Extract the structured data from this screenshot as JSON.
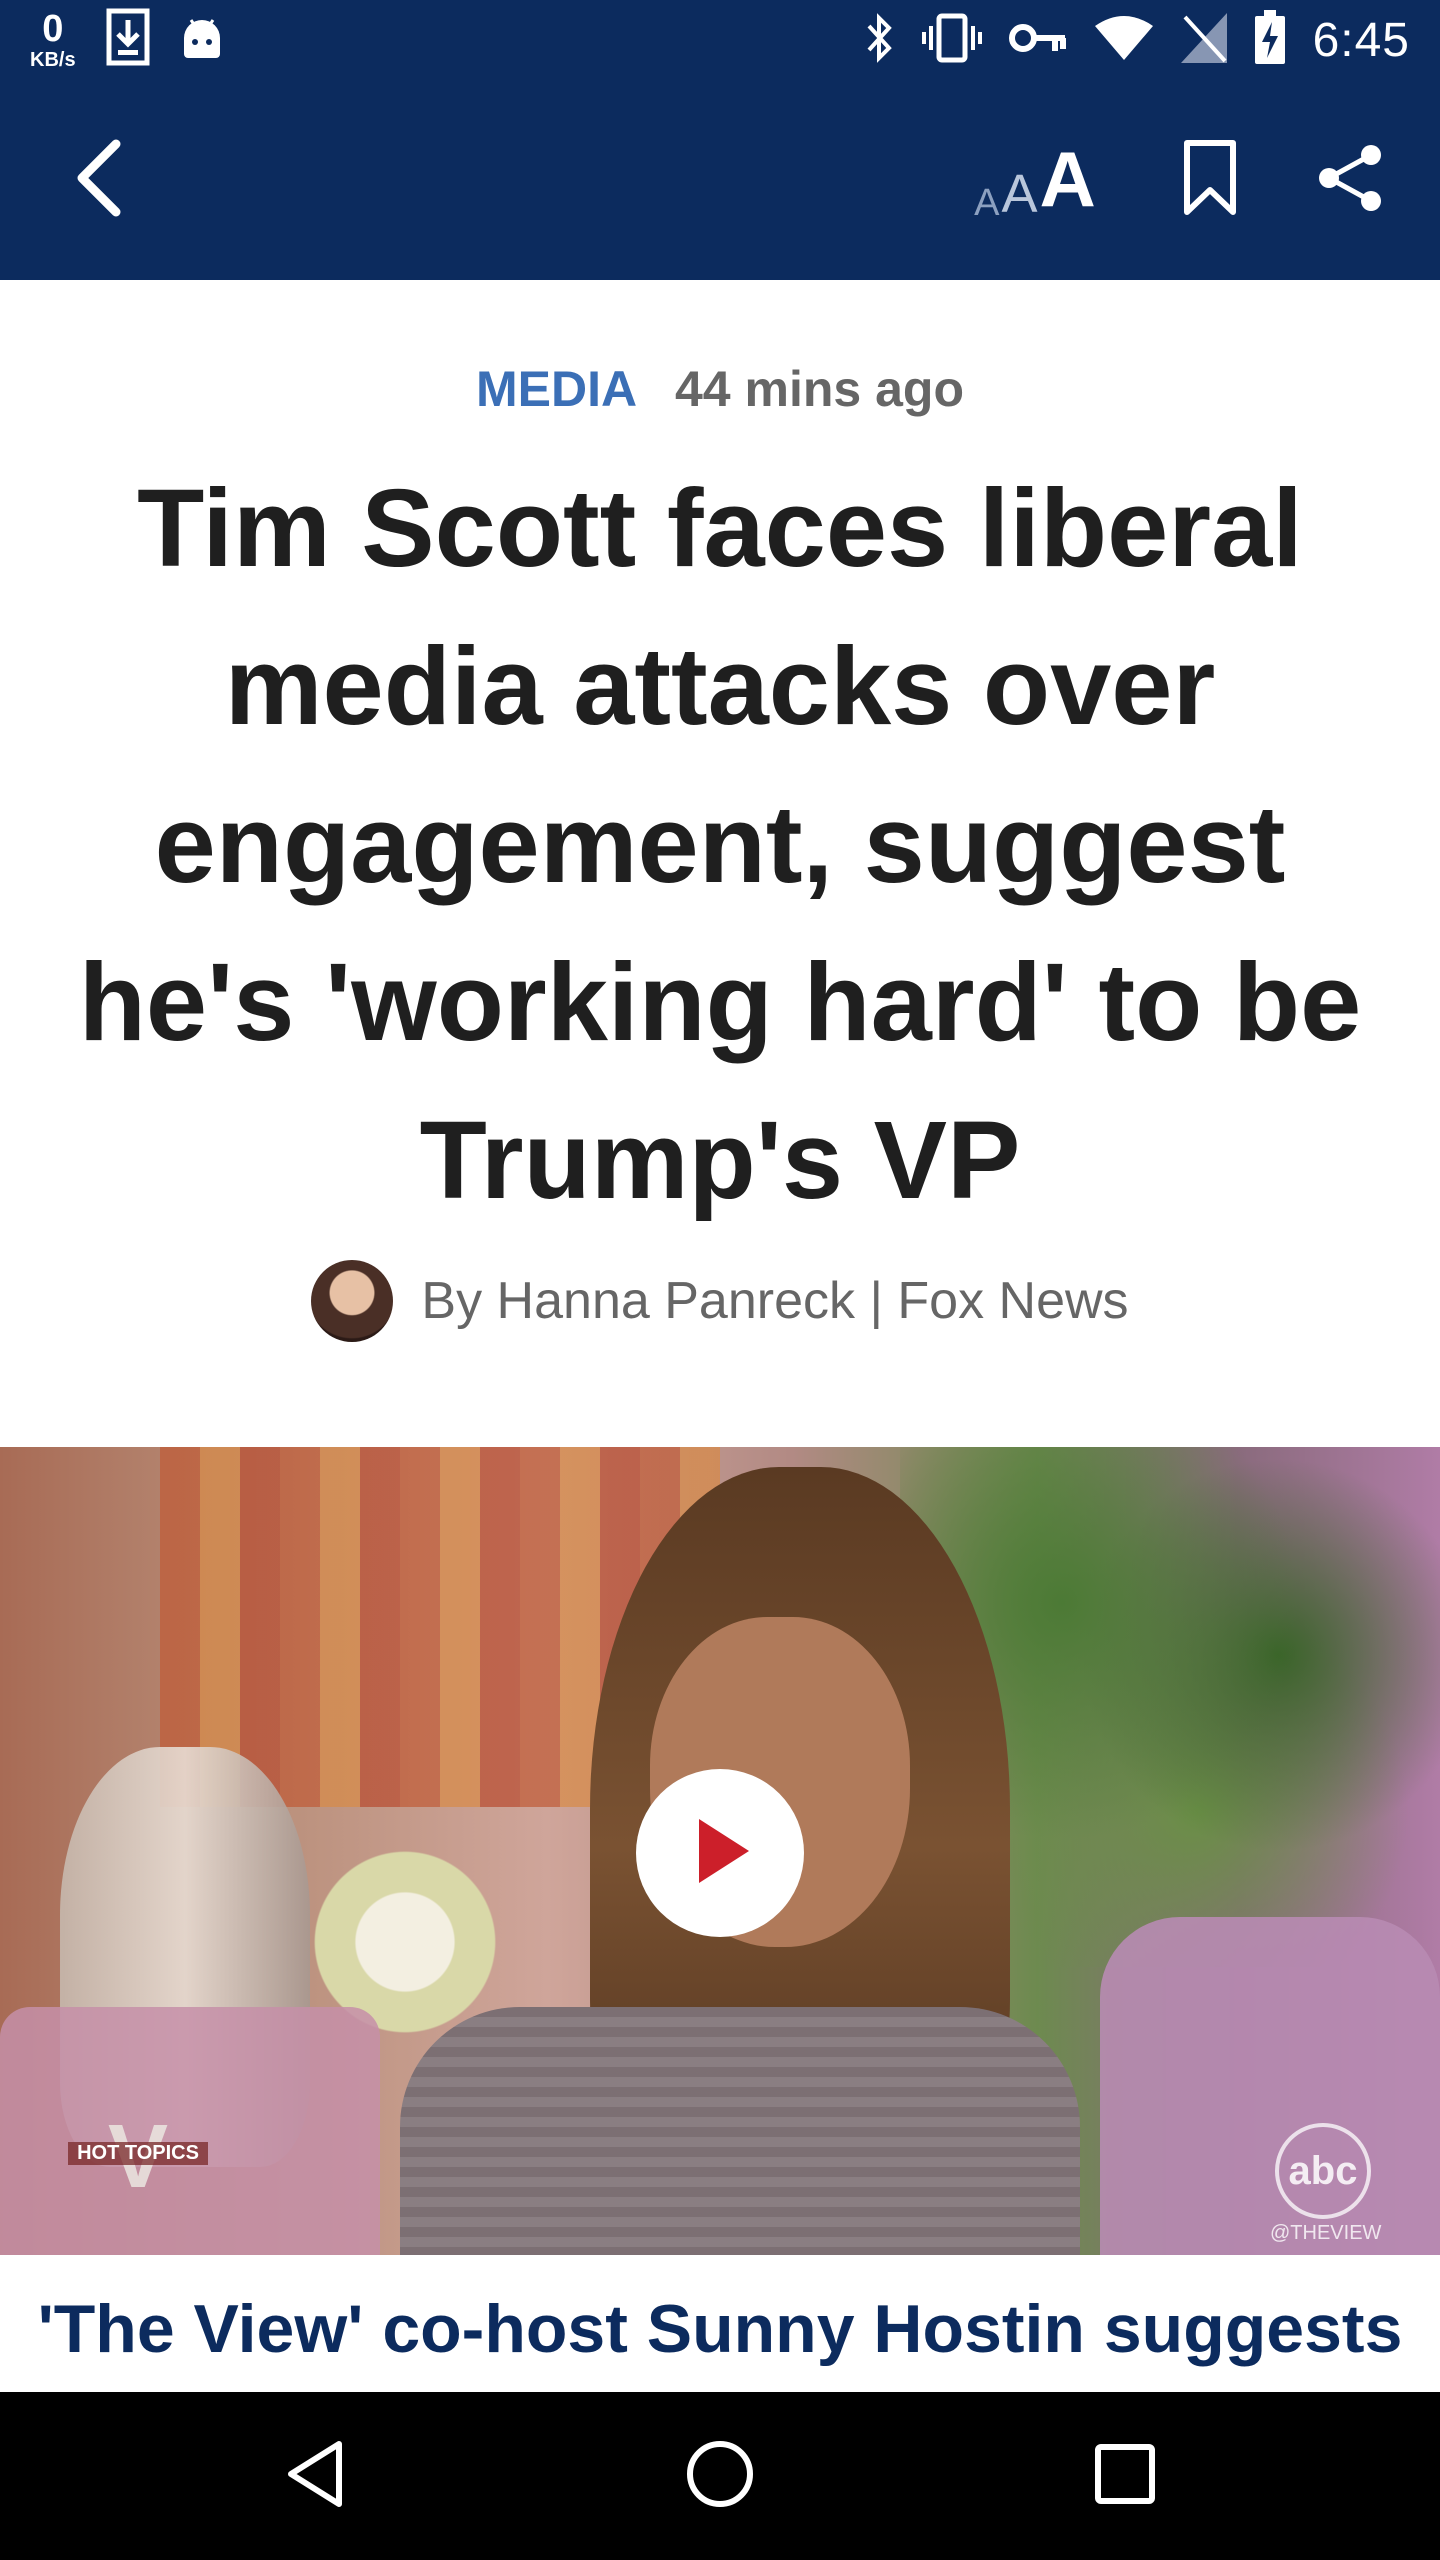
{
  "status_bar": {
    "net_speed_value": "0",
    "net_speed_unit": "KB/s",
    "time": "6:45",
    "icons": [
      "download-icon",
      "android-icon",
      "bluetooth-icon",
      "vibrate-icon",
      "vpn-key-icon",
      "wifi-icon",
      "no-sim-icon",
      "battery-charging-icon"
    ]
  },
  "toolbar": {
    "back_icon": "chevron-left-icon",
    "font_size_icon": "text-size-icon",
    "font_size_glyphs": [
      "A",
      "A",
      "A"
    ],
    "bookmark_icon": "bookmark-icon",
    "share_icon": "share-icon",
    "background_color": "#0c2b5e"
  },
  "article": {
    "category": "MEDIA",
    "time_ago": "44 mins ago",
    "headline": "Tim Scott faces liberal media attacks over engagement, suggest he's 'working hard' to be Trump's VP",
    "byline": "By Hanna Panreck | Fox News",
    "category_color": "#3b6fb6"
  },
  "video": {
    "play_icon": "play-icon",
    "overlay_show_logo_text": "V",
    "overlay_segment_label": "HOT TOPICS",
    "network_logo_text": "abc",
    "network_handle": "@THEVIEW",
    "caption": "'The View' co-host Sunny Hostin suggests"
  },
  "nav_bar": {
    "icons": [
      "back-triangle-icon",
      "home-circle-icon",
      "recents-square-icon"
    ]
  }
}
